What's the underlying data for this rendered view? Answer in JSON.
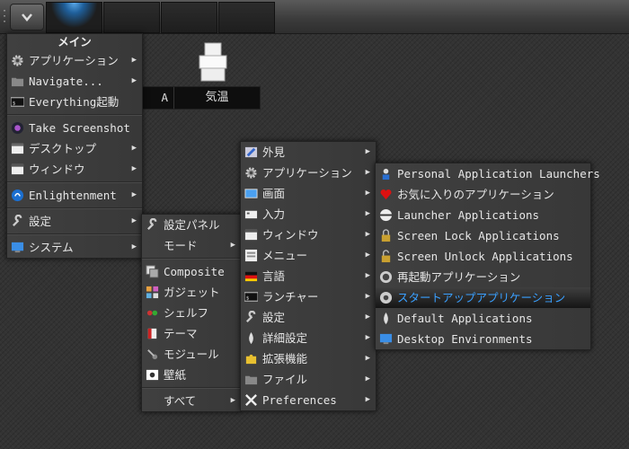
{
  "gadget": {
    "left_label": "A",
    "right_label": "気温"
  },
  "main_menu": {
    "title": "メイン",
    "items": [
      {
        "label": "アプリケーション",
        "icon": "gear-icon",
        "submenu": true
      },
      {
        "label": "Navigate...",
        "icon": "folder-icon",
        "submenu": true
      },
      {
        "label": "Everything起動",
        "icon": "terminal-icon",
        "submenu": false
      },
      {
        "label": "Take Screenshot",
        "icon": "camera-icon",
        "submenu": false
      },
      {
        "label": "デスクトップ",
        "icon": "desktop-icon",
        "submenu": true
      },
      {
        "label": "ウィンドウ",
        "icon": "window-icon",
        "submenu": true
      },
      {
        "label": "Enlightenment",
        "icon": "enlightenment-icon",
        "submenu": true
      },
      {
        "label": "設定",
        "icon": "wrench-icon",
        "submenu": true
      },
      {
        "label": "システム",
        "icon": "monitor-icon",
        "submenu": true
      }
    ]
  },
  "settings_menu": {
    "items": [
      {
        "label": "設定パネル",
        "icon": "wrench-icon",
        "submenu": false
      },
      {
        "label": "モード",
        "icon": "",
        "submenu": true
      },
      {
        "label": "Composite",
        "icon": "composite-icon",
        "submenu": false
      },
      {
        "label": "ガジェット",
        "icon": "gadget-icon",
        "submenu": false
      },
      {
        "label": "シェルフ",
        "icon": "shelf-icon",
        "submenu": false
      },
      {
        "label": "テーマ",
        "icon": "theme-icon",
        "submenu": false
      },
      {
        "label": "モジュール",
        "icon": "module-icon",
        "submenu": false
      },
      {
        "label": "壁紙",
        "icon": "wallpaper-icon",
        "submenu": false
      },
      {
        "label": "すべて",
        "icon": "",
        "submenu": true
      }
    ]
  },
  "all_menu": {
    "items": [
      {
        "label": "外見",
        "icon": "appearance-icon",
        "submenu": true
      },
      {
        "label": "アプリケーション",
        "icon": "gear-icon",
        "submenu": true
      },
      {
        "label": "画面",
        "icon": "screen-icon",
        "submenu": true
      },
      {
        "label": "入力",
        "icon": "keyboard-icon",
        "submenu": true
      },
      {
        "label": "ウィンドウ",
        "icon": "window-icon",
        "submenu": true
      },
      {
        "label": "メニュー",
        "icon": "menu-icon",
        "submenu": true
      },
      {
        "label": "言語",
        "icon": "flag-icon",
        "submenu": true
      },
      {
        "label": "ランチャー",
        "icon": "terminal-icon",
        "submenu": true
      },
      {
        "label": "設定",
        "icon": "wrench-icon",
        "submenu": true
      },
      {
        "label": "詳細設定",
        "icon": "drop-icon",
        "submenu": true
      },
      {
        "label": "拡張機能",
        "icon": "puzzle-icon",
        "submenu": true
      },
      {
        "label": "ファイル",
        "icon": "folder-icon",
        "submenu": true
      },
      {
        "label": "Preferences",
        "icon": "tools-icon",
        "submenu": true
      }
    ]
  },
  "apps_menu": {
    "items": [
      {
        "label": "Personal Application Launchers",
        "icon": "user-icon"
      },
      {
        "label": "お気に入りのアプリケーション",
        "icon": "heart-icon"
      },
      {
        "label": "Launcher Applications",
        "icon": "launcher-icon"
      },
      {
        "label": "Screen Lock Applications",
        "icon": "lock-icon"
      },
      {
        "label": "Screen Unlock Applications",
        "icon": "unlock-icon"
      },
      {
        "label": "再起動アプリケーション",
        "icon": "restart-icon"
      },
      {
        "label": "スタートアップアプリケーション",
        "icon": "startup-icon",
        "selected": true
      },
      {
        "label": "Default Applications",
        "icon": "drop-icon"
      },
      {
        "label": "Desktop Environments",
        "icon": "desktop-env-icon"
      }
    ]
  }
}
